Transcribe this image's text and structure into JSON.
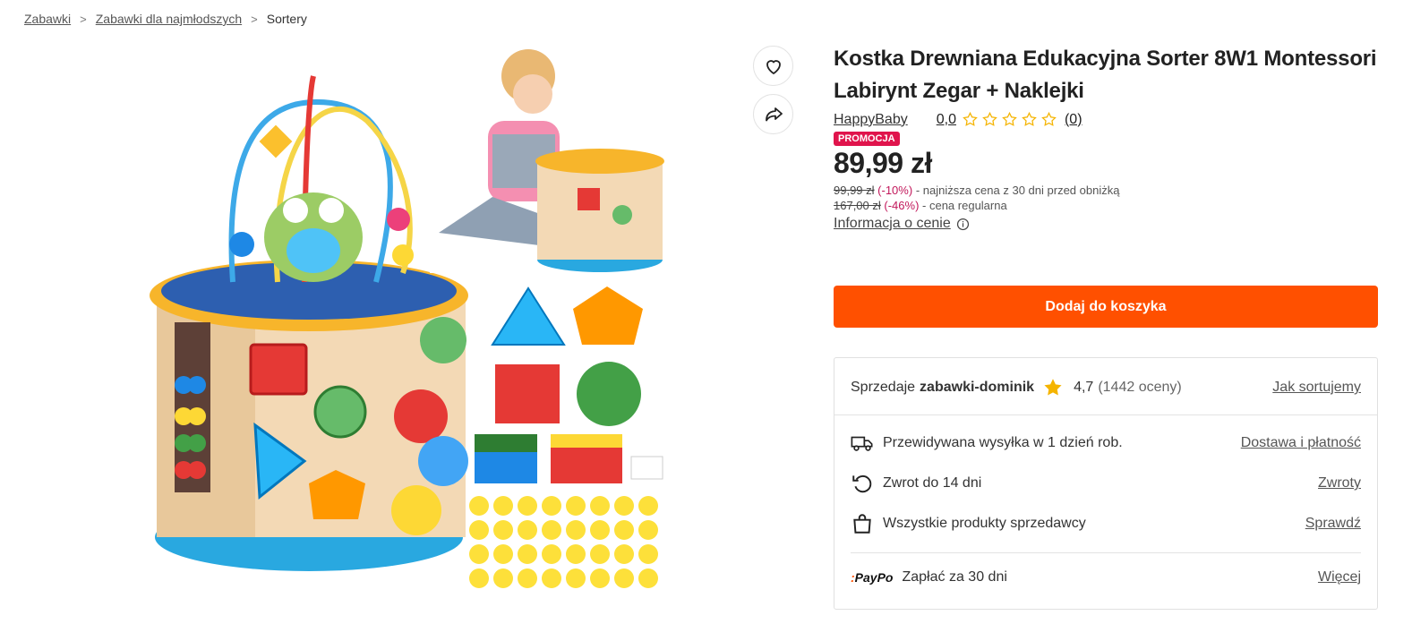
{
  "breadcrumb": {
    "items": [
      "Zabawki",
      "Zabawki dla najmłodszych"
    ],
    "current": "Sortery",
    "separator": ">"
  },
  "product": {
    "title": "Kostka Drewniana Edukacyjna Sorter 8W1 Montessori Labirynt Zegar + Naklejki",
    "brand": "HappyBaby",
    "rating": "0,0",
    "rating_count": "(0)",
    "promo_badge": "PROMOCJA",
    "price": "89,99 zł",
    "lowest_price_old": "99,99 zł",
    "lowest_price_pct": "(-10%)",
    "lowest_price_text": "- najniższa cena z 30 dni przed obniżką",
    "regular_price_old": "167,00 zł",
    "regular_price_pct": "(-46%)",
    "regular_price_text": "- cena regularna",
    "price_info_label": "Informacja o cenie",
    "add_to_cart": "Dodaj do koszyka"
  },
  "seller": {
    "prefix": "Sprzedaje",
    "name": "zabawki-dominik",
    "score": "4,7",
    "reviews": "(1442 oceny)",
    "sort_link": "Jak sortujemy"
  },
  "delivery": {
    "shipping": "Przewidywana wysyłka w 1 dzień rob.",
    "shipping_link": "Dostawa i płatność",
    "returns": "Zwrot do 14 dni",
    "returns_link": "Zwroty",
    "all_products": "Wszystkie produkty sprzedawcy",
    "all_products_link": "Sprawdź",
    "paypo_logo": "PayPo",
    "paypo_text": "Zapłać za 30 dni",
    "paypo_link": "Więcej"
  },
  "colors": {
    "accent": "#ff5000",
    "promo": "#e0144c",
    "discount": "#c2185b",
    "star": "#f5b400"
  }
}
